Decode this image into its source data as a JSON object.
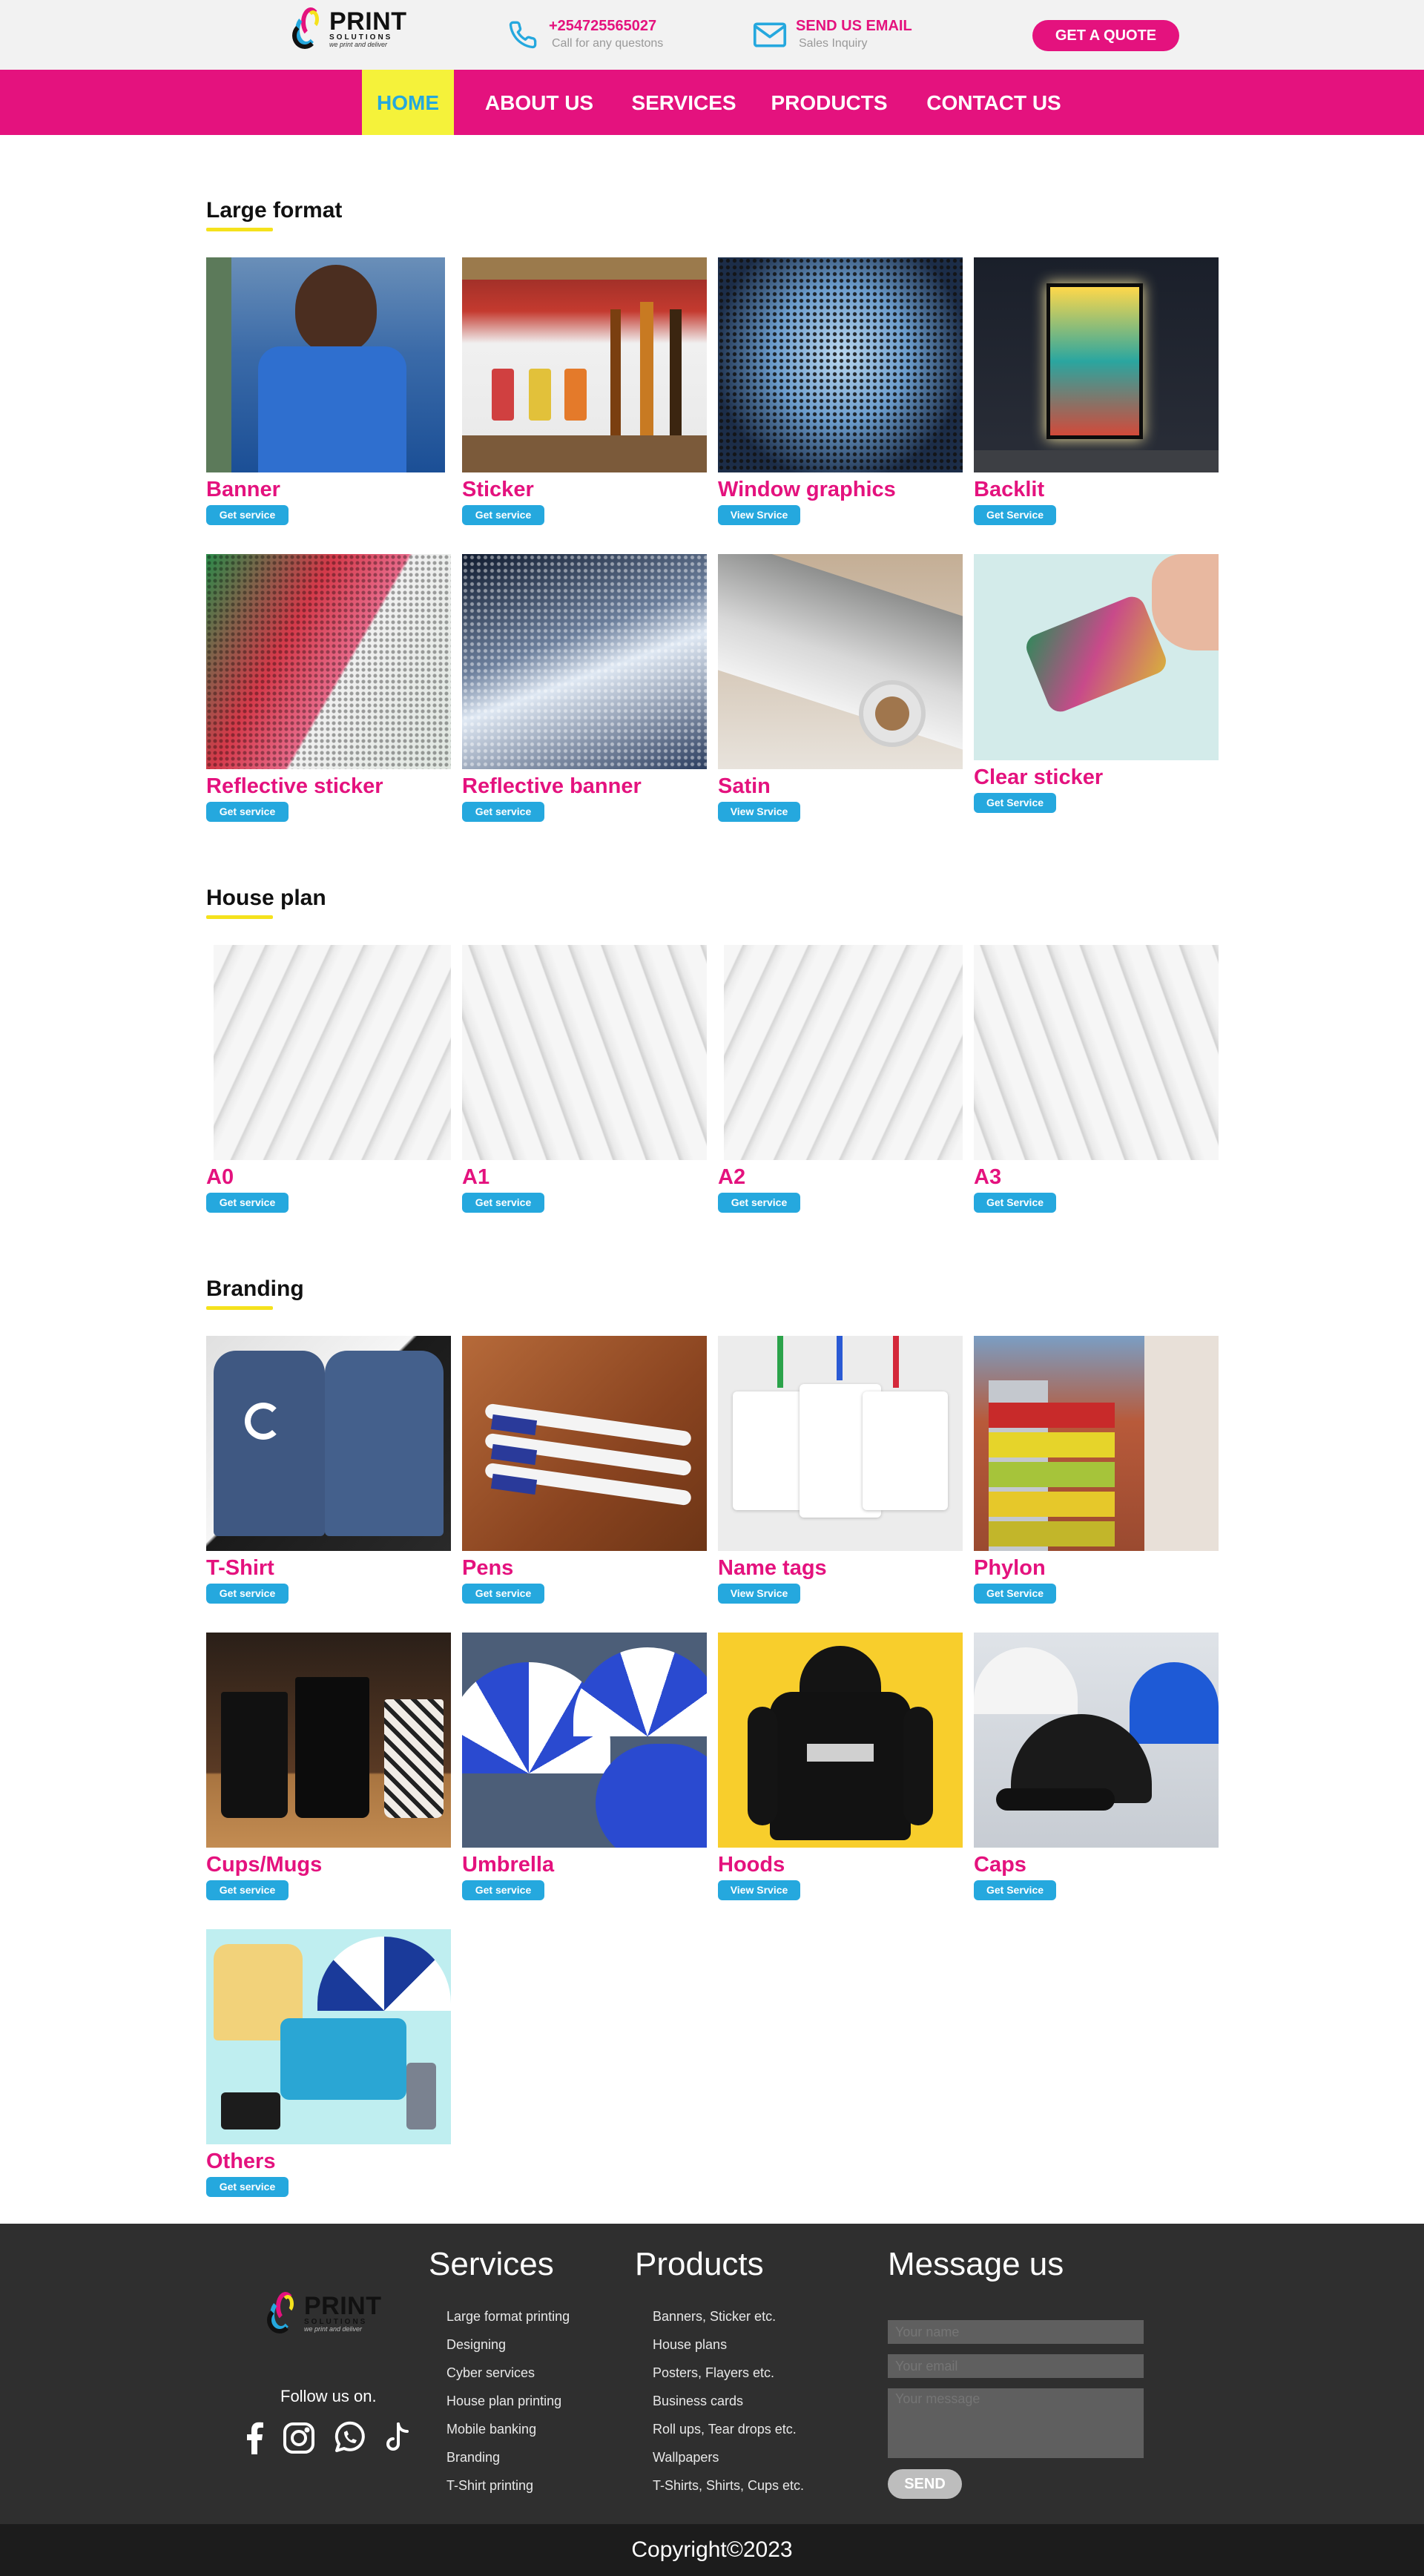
{
  "header": {
    "logo": {
      "word": "PRINT",
      "sub": "SOLUTIONS",
      "tagline": "we print and deliver"
    },
    "phone": {
      "number": "+254725565027",
      "caption": "Call for any questons"
    },
    "email": {
      "label": "SEND US EMAIL",
      "caption": "Sales Inquiry"
    },
    "quote_label": "GET A QUOTE"
  },
  "nav": {
    "items": [
      "HOME",
      "ABOUT US",
      "SERVICES",
      "PRODUCTS",
      "CONTACT US"
    ],
    "active": "HOME"
  },
  "sections": {
    "large_format": {
      "title": "Large format",
      "items": [
        {
          "name": "Banner",
          "button": "Get service",
          "icon": "banner-photo"
        },
        {
          "name": "Sticker",
          "button": "Get service",
          "icon": "sticker-photo"
        },
        {
          "name": "Window graphics",
          "button": "View Srvice",
          "icon": "window-graphics-photo"
        },
        {
          "name": "Backlit",
          "button": "Get Service",
          "icon": "backlit-photo"
        },
        {
          "name": "Reflective sticker",
          "button": "Get service",
          "icon": "reflective-sticker-photo"
        },
        {
          "name": "Reflective banner",
          "button": "Get service",
          "icon": "reflective-banner-photo"
        },
        {
          "name": "Satin",
          "button": "View Srvice",
          "icon": "satin-roll-photo"
        },
        {
          "name": "Clear sticker",
          "button": "Get Service",
          "icon": "clear-sticker-photo"
        }
      ]
    },
    "house_plan": {
      "title": "House plan",
      "items": [
        {
          "name": "A0",
          "button": "Get service",
          "icon": "blueprint-photo"
        },
        {
          "name": "A1",
          "button": "Get service",
          "icon": "blueprint-photo"
        },
        {
          "name": "A2",
          "button": "Get service",
          "icon": "blueprint-photo"
        },
        {
          "name": "A3",
          "button": "Get Service",
          "icon": "blueprint-photo"
        }
      ]
    },
    "branding": {
      "title": "Branding",
      "items": [
        {
          "name": "T-Shirt",
          "button": "Get service",
          "icon": "tshirt-photo"
        },
        {
          "name": "Pens",
          "button": "Get service",
          "icon": "pens-photo"
        },
        {
          "name": "Name tags",
          "button": "View Srvice",
          "icon": "name-tags-photo"
        },
        {
          "name": "Phylon",
          "button": "Get Service",
          "icon": "phylon-photo"
        },
        {
          "name": "Cups/Mugs",
          "button": "Get service",
          "icon": "cups-photo"
        },
        {
          "name": "Umbrella",
          "button": "Get service",
          "icon": "umbrella-photo"
        },
        {
          "name": "Hoods",
          "button": "View Srvice",
          "icon": "hoodie-photo"
        },
        {
          "name": "Caps",
          "button": "Get Service",
          "icon": "caps-photo"
        },
        {
          "name": "Others",
          "button": "Get service",
          "icon": "others-photo"
        }
      ]
    }
  },
  "footer": {
    "logo": {
      "word": "PRINT",
      "sub": "SOLUTIONS",
      "tagline": "we print and deliver"
    },
    "follow_label": "Follow us on.",
    "socials": [
      "facebook-icon",
      "instagram-icon",
      "whatsapp-icon",
      "tiktok-icon"
    ],
    "services_title": "Services",
    "services": [
      "Large format printing",
      "Designing",
      "Cyber services",
      "House plan printing",
      "Mobile banking",
      "Branding",
      "T-Shirt printing"
    ],
    "products_title": "Products",
    "products": [
      "Banners, Sticker etc.",
      "House plans",
      "Posters, Flayers etc.",
      "Business cards",
      "Roll ups, Tear drops etc.",
      "Wallpapers",
      "T-Shirts, Shirts, Cups etc."
    ],
    "message_title": "Message us",
    "name_placeholder": "Your name",
    "email_placeholder": "Your email",
    "message_placeholder": "Your message",
    "send_label": "SEND"
  },
  "copyright": "Copyright©2023",
  "colors": {
    "brand_pink": "#e4127e",
    "accent_blue": "#25a8de",
    "accent_yellow": "#f5f23a",
    "footer_bg": "#2f2f2f"
  }
}
